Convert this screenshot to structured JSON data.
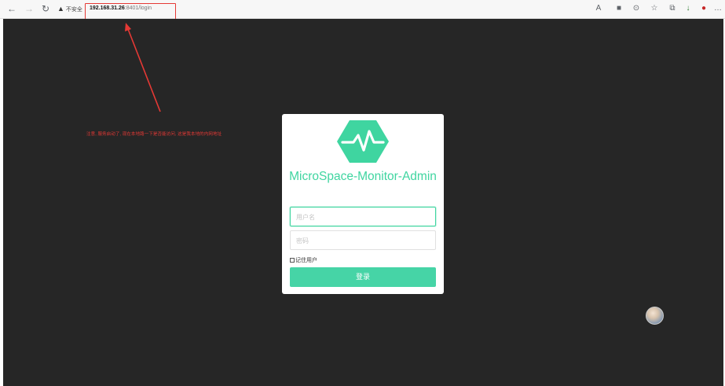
{
  "browser": {
    "security_label": "不安全",
    "url_host": "192.168.31.26",
    "url_rest": ":8401/login",
    "nav_icons": [
      "back-arrow-icon",
      "forward-arrow-icon",
      "reload-icon"
    ],
    "toolbar_icons": [
      "read-aloud-icon",
      "app-icon",
      "extension-icon",
      "favorites-icon",
      "collections-icon",
      "download-icon",
      "profile-icon",
      "more-icon"
    ]
  },
  "annotation": {
    "text": "注意, 服务启动了, 现在本地路一下是否能访问, 这是我本地的内网地址",
    "color": "#e53935"
  },
  "login": {
    "title": "MicroSpace-Monitor-Admin",
    "username_placeholder": "用户名",
    "password_placeholder": "密码",
    "remember_label": "记住用户",
    "submit_label": "登录",
    "accent_color": "#46d4a6"
  }
}
